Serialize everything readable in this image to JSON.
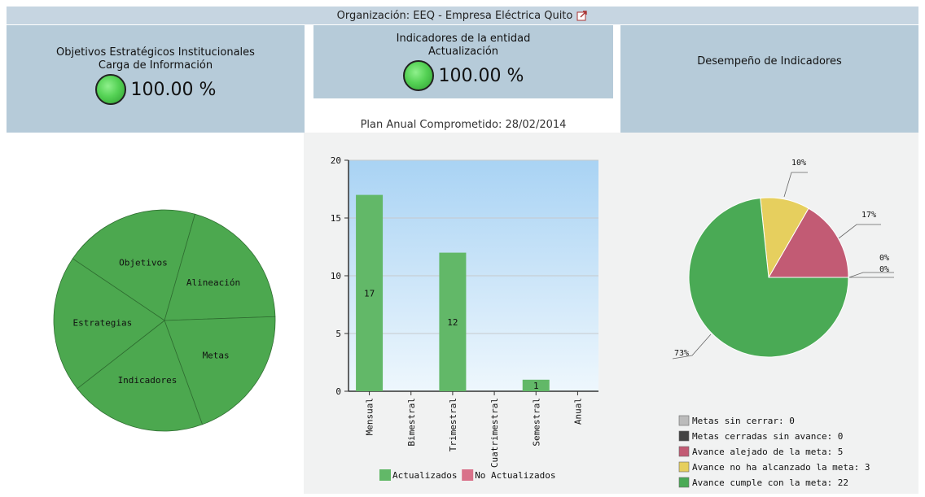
{
  "header": {
    "organization_label": "Organización: EEQ - Empresa Eléctrica Quito",
    "link_icon": "external-link-icon"
  },
  "panel_left": {
    "title_line1": "Objetivos Estratégicos Institucionales",
    "title_line2": "Carga de Información",
    "percentage": "100.00 %",
    "status_color": "#55d255"
  },
  "panel_middle": {
    "title_line1": "Indicadores de la entidad",
    "title_line2": "Actualización",
    "percentage": "100.00 %",
    "plan_label": "Plan Anual Comprometido: 28/02/2014"
  },
  "panel_right": {
    "title": "Desempeño de Indicadores"
  },
  "chart_data": [
    {
      "type": "pie",
      "title": "",
      "slices": [
        {
          "label": "Objetivos",
          "value": 1
        },
        {
          "label": "Alineación",
          "value": 1
        },
        {
          "label": "Metas",
          "value": 1
        },
        {
          "label": "Indicadores",
          "value": 1
        },
        {
          "label": "Estrategias",
          "value": 1
        }
      ],
      "colors": [
        "#4ca84f"
      ]
    },
    {
      "type": "bar",
      "categories": [
        "Mensual",
        "Bimestral",
        "Trimestral",
        "Cuatrimestral",
        "Semestral",
        "Anual"
      ],
      "series": [
        {
          "name": "Actualizados",
          "values": [
            17,
            0,
            12,
            0,
            1,
            0
          ],
          "color": "#62b868"
        },
        {
          "name": "No Actualizados",
          "values": [
            0,
            0,
            0,
            0,
            0,
            0
          ],
          "color": "#d9728a"
        }
      ],
      "data_labels": [
        "17",
        "",
        "12",
        "",
        "1",
        ""
      ],
      "ylim": [
        0,
        20
      ],
      "yticks": [
        "0",
        "5",
        "10",
        "15",
        "20"
      ],
      "grid": true,
      "legend_position": "bottom"
    },
    {
      "type": "pie",
      "slices": [
        {
          "label": "0%",
          "name": "Metas sin cerrar: 0",
          "value": 0,
          "color": "#bbbbbb"
        },
        {
          "label": "0%",
          "name": "Metas cerradas sin avance: 0",
          "value": 0,
          "color": "#444444"
        },
        {
          "label": "17%",
          "name": "Avance alejado de la meta: 5",
          "value": 5,
          "color": "#c25b74"
        },
        {
          "label": "10%",
          "name": "Avance no ha alcanzado la meta: 3",
          "value": 3,
          "color": "#e6cf5e"
        },
        {
          "label": "73%",
          "name": "Avance cumple con la meta: 22",
          "value": 22,
          "color": "#4aaa55"
        }
      ],
      "legend_position": "bottom-left"
    }
  ]
}
